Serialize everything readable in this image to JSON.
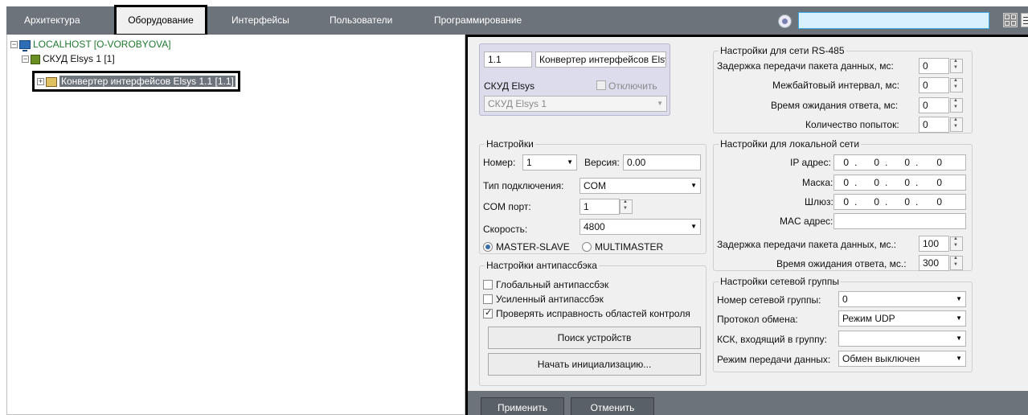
{
  "tabs": [
    "Архитектура",
    "Оборудование",
    "Интерфейсы",
    "Пользователи",
    "Программирование"
  ],
  "tree": {
    "root": "LOCALHOST [O-VOROBYOVA]",
    "skud": "СКУД Elsys 1 [1]",
    "converter": "Конвертер интерфейсов Elsys 1.1 [1.1]"
  },
  "device": {
    "id": "1.1",
    "name": "Конвертер интерфейсов Elsy",
    "type_label": "СКУД Elsys",
    "disable_label": "Отключить",
    "parent": "СКУД Elsys 1"
  },
  "settings": {
    "title": "Настройки",
    "number_label": "Номер:",
    "number": "1",
    "version_label": "Версия:",
    "version": "0.00",
    "conn_type_label": "Тип подключения:",
    "conn_type": "COM",
    "com_port_label": "COM порт:",
    "com_port": "1",
    "speed_label": "Скорость:",
    "speed": "4800",
    "mode_master_slave": "MASTER-SLAVE",
    "mode_multimaster": "MULTIMASTER"
  },
  "antipassback": {
    "title": "Настройки антипассбэка",
    "global": "Глобальный антипассбэк",
    "enhanced": "Усиленный антипассбэк",
    "check_areas": "Проверять исправность областей контроля"
  },
  "buttons": {
    "search": "Поиск устройств",
    "init": "Начать инициализацию...",
    "apply": "Применить",
    "cancel": "Отменить"
  },
  "rs485": {
    "title": "Настройки для сети RS-485",
    "delay_label": "Задержка передачи пакета данных, мс:",
    "delay": "0",
    "interbyte_label": "Межбайтовый интервал, мс:",
    "interbyte": "0",
    "timeout_label": "Время ожидания ответа, мс:",
    "timeout": "0",
    "attempts_label": "Количество попыток:",
    "attempts": "0"
  },
  "lan": {
    "title": "Настройки для локальной сети",
    "ip_label": "IP адрес:",
    "mask_label": "Маска:",
    "gateway_label": "Шлюз:",
    "ip_segment": "0",
    "ip_dot": ".",
    "mac_label": "MAC адрес:",
    "mac": "",
    "delay_label": "Задержка передачи пакета данных, мс.:",
    "delay": "100",
    "timeout_label": "Время ожидания ответа, мс.:",
    "timeout": "300"
  },
  "netgroup": {
    "title": "Настройки сетевой группы",
    "number_label": "Номер сетевой группы:",
    "number": "0",
    "protocol_label": "Протокол обмена:",
    "protocol": "Режим UDP",
    "ksk_label": "КСК, входящий в группу:",
    "ksk": "",
    "mode_label": "Режим передачи данных:",
    "mode": "Обмен выключен"
  }
}
